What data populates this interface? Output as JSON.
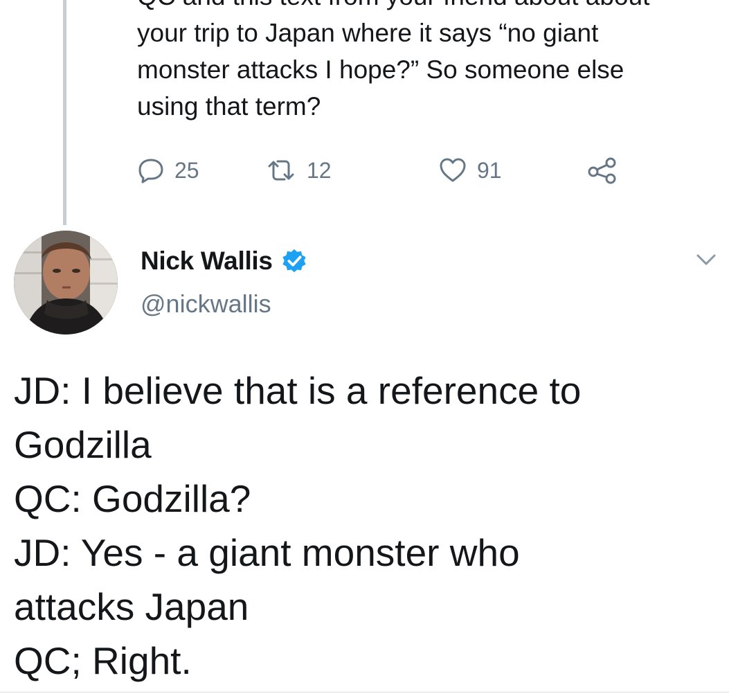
{
  "previous_tweet": {
    "text_lines": [
      "QC and this text from your friend about about",
      "your trip to Japan where it says “no giant",
      "monster attacks I hope?” So someone else",
      "using that term?"
    ],
    "actions": {
      "replies": "25",
      "retweets": "12",
      "likes": "91"
    }
  },
  "tweet": {
    "display_name": "Nick Wallis",
    "handle": "@nickwallis",
    "body_lines": [
      "JD: I believe that is a reference to",
      "Godzilla",
      "QC: Godzilla?",
      "JD: Yes - a giant monster who",
      "attacks Japan",
      "QC; Right."
    ]
  },
  "colors": {
    "verified_badge": "#1da1f2",
    "muted_text": "#657786",
    "primary_text": "#14171a",
    "thread_line": "#c6ced4"
  },
  "icons": {
    "reply": "reply-icon",
    "retweet": "retweet-icon",
    "like": "heart-icon",
    "share": "share-icon",
    "verified": "verified-badge-icon",
    "more": "chevron-down-icon"
  }
}
